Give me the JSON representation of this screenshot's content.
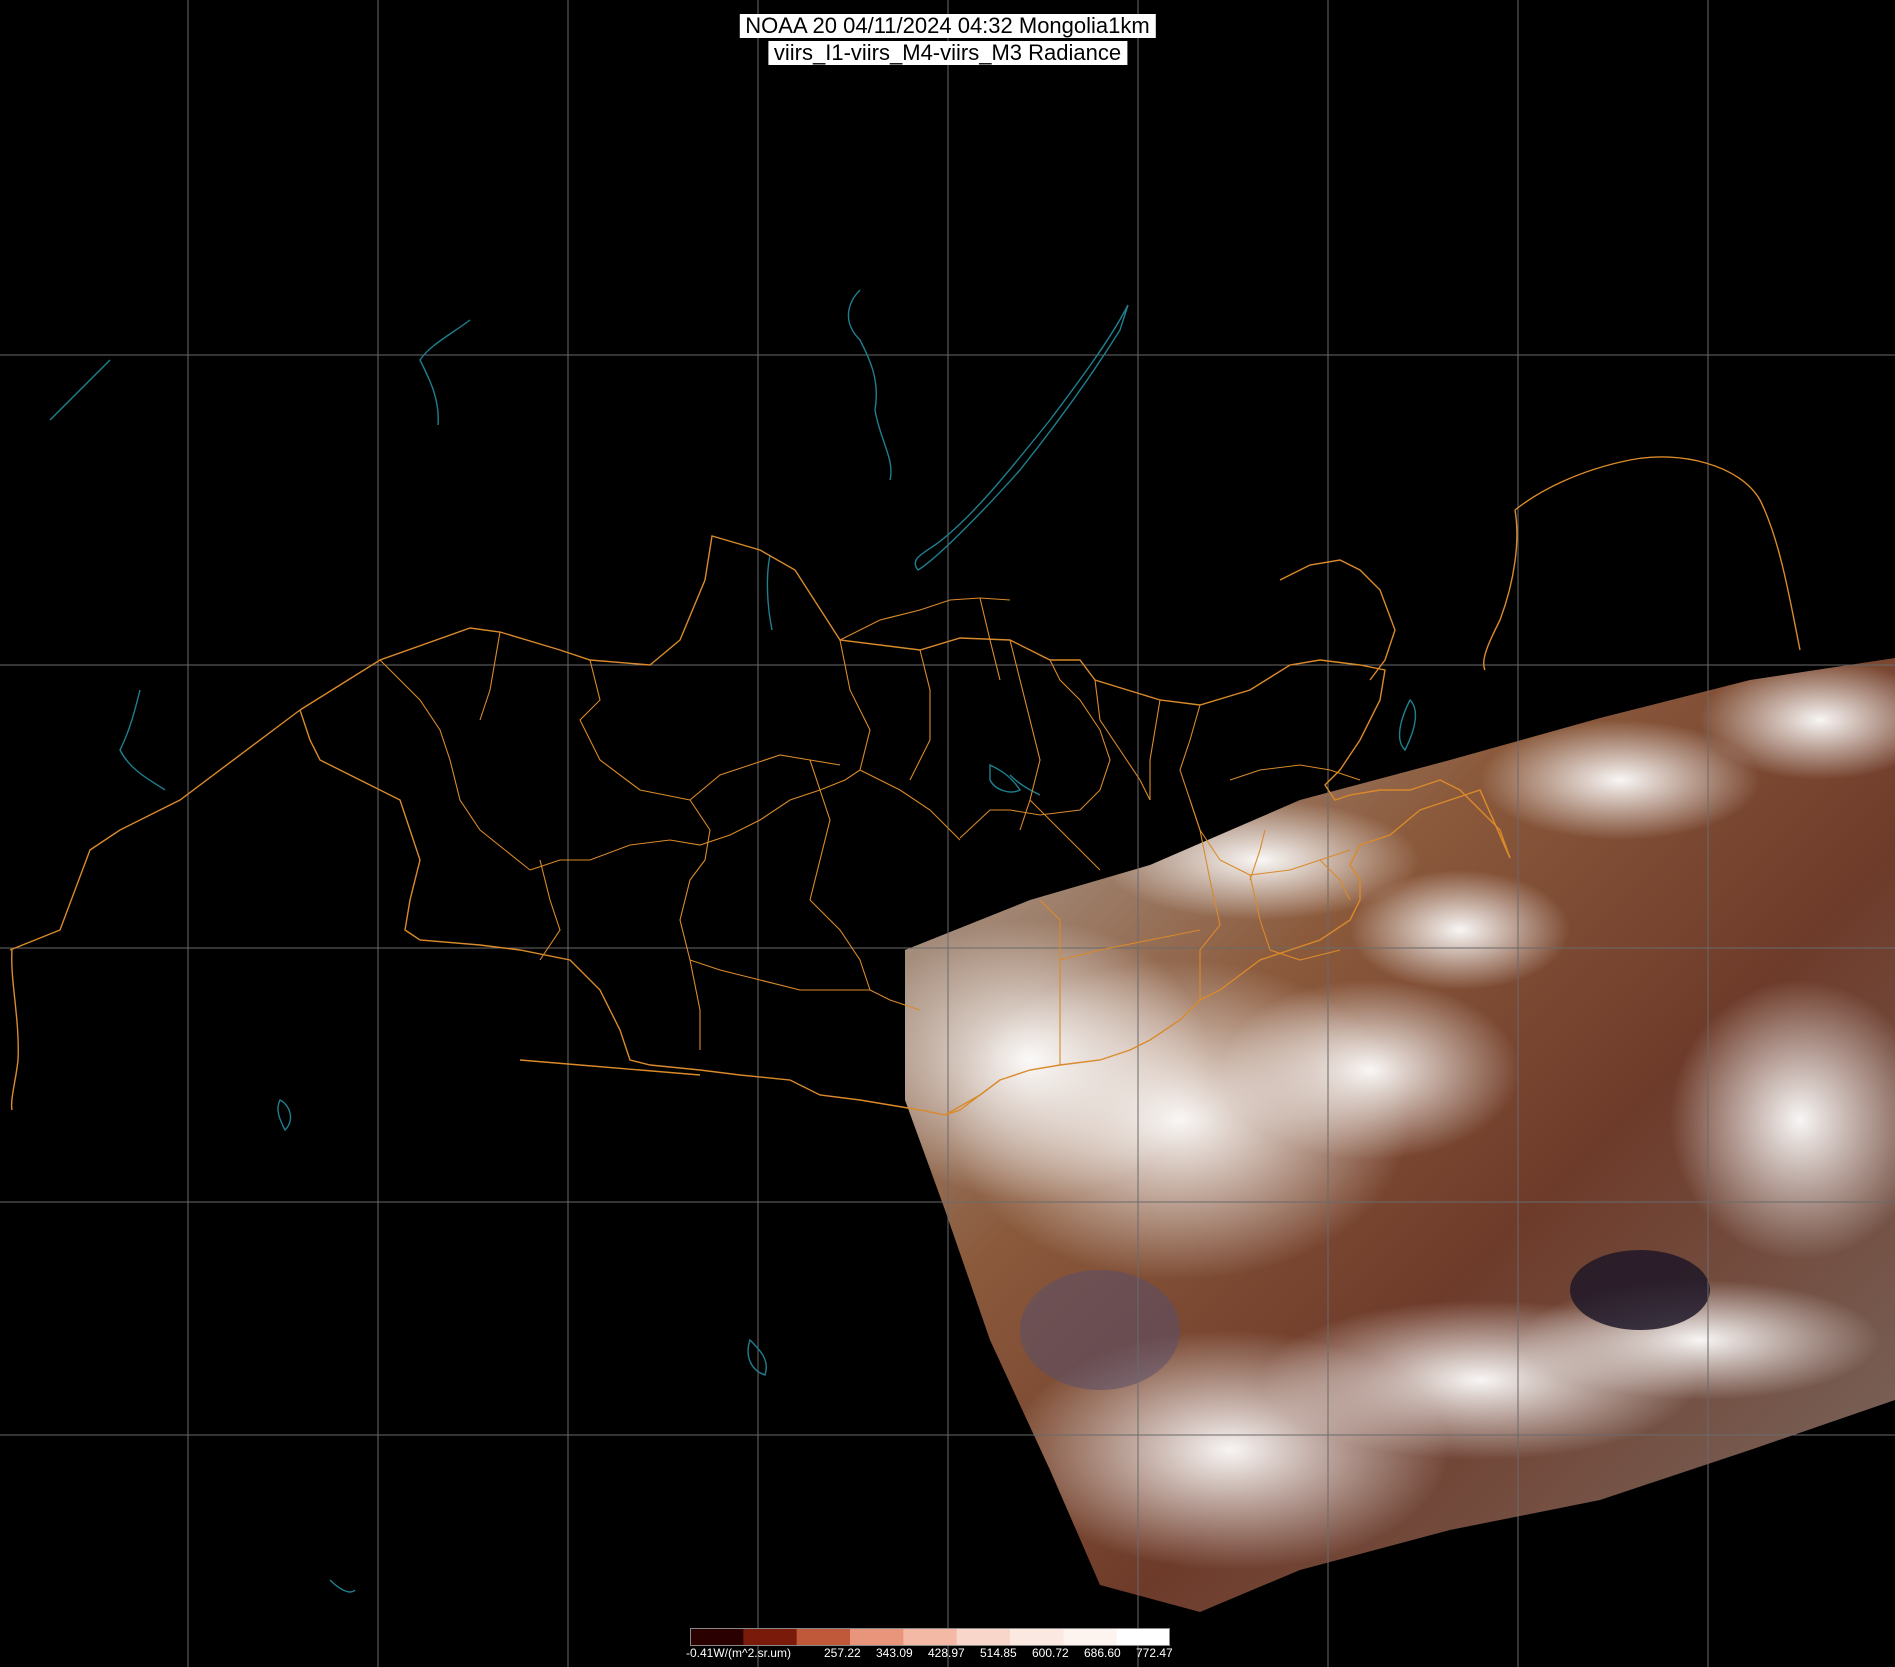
{
  "header": {
    "line1": "NOAA 20 04/11/2024 04:32 Mongolia1km",
    "line2": "viirs_I1-viirs_M4-viirs_M3 Radiance"
  },
  "colorbar": {
    "labels": [
      "-0.41W/(m^2.sr.um)",
      "257.22",
      "343.09",
      "428.97",
      "514.85",
      "600.72",
      "686.60",
      "772.47"
    ],
    "colors": [
      "#2a0000",
      "#7a1a0a",
      "#c0583a",
      "#e8957c",
      "#f3b9a4",
      "#f8d6c9",
      "#fbe8e0",
      "#fdf3ef",
      "#ffffff"
    ]
  },
  "colors": {
    "border": "#d98a2b",
    "water": "#1f7f8f",
    "grid": "#6a6a6a",
    "background": "#000000"
  }
}
